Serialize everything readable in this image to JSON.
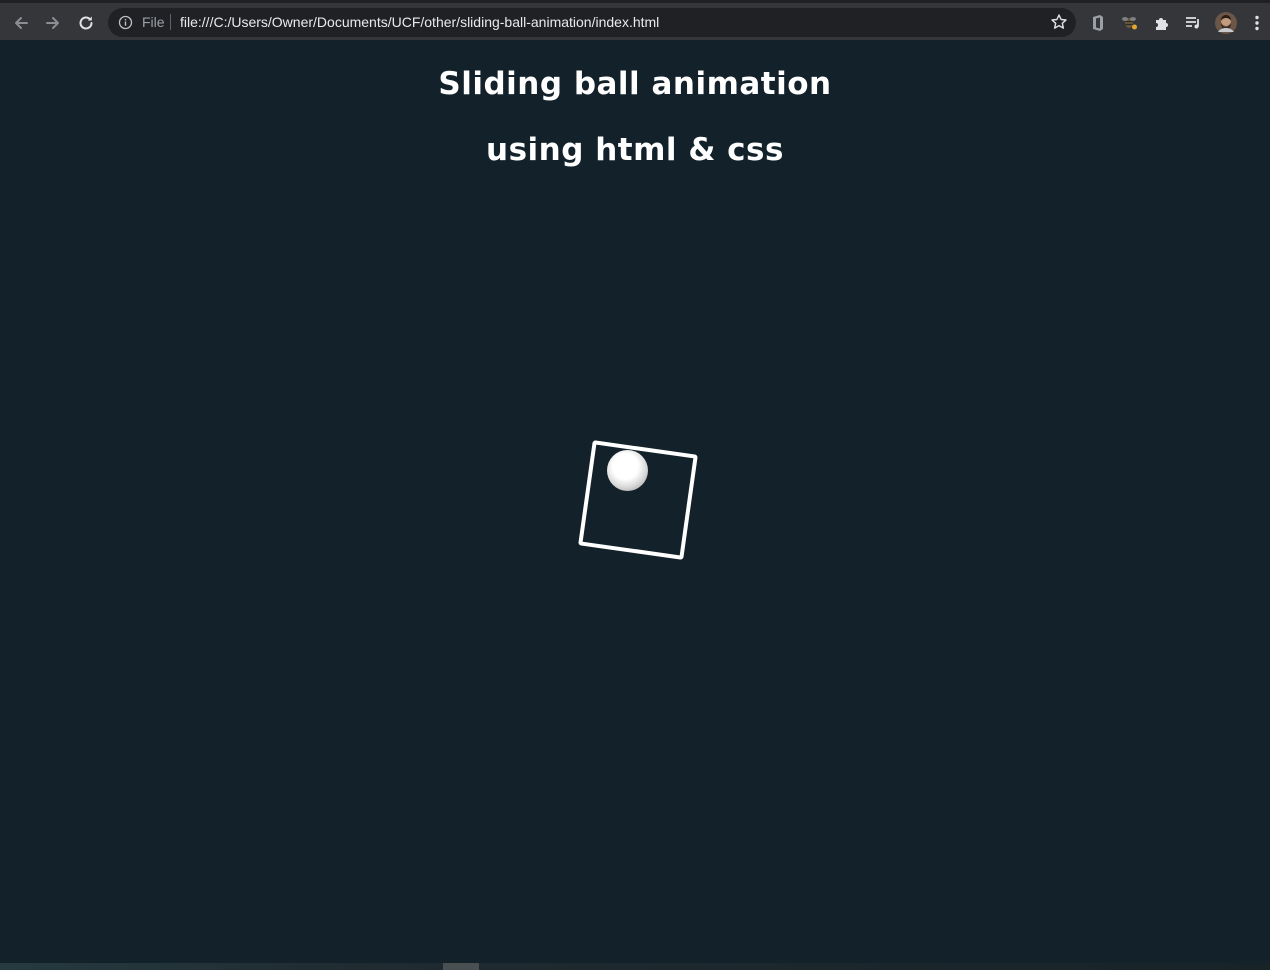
{
  "browser": {
    "file_label": "File",
    "url": "file:///C:/Users/Owner/Documents/UCF/other/sliding-ball-animation/index.html",
    "icons": [
      "back-arrow-icon",
      "forward-arrow-icon",
      "reload-icon",
      "info-icon",
      "star-icon",
      "office-extension-icon",
      "bee-extension-icon",
      "puzzle-extensions-icon",
      "media-queue-icon",
      "profile-avatar",
      "kebab-menu-icon"
    ]
  },
  "page": {
    "title_line_1": "Sliding ball animation",
    "title_line_2": "using html & css",
    "colors": {
      "background": "#13212a",
      "text": "#ffffff",
      "box_border": "#ffffff",
      "ball": "#ffffff"
    }
  }
}
